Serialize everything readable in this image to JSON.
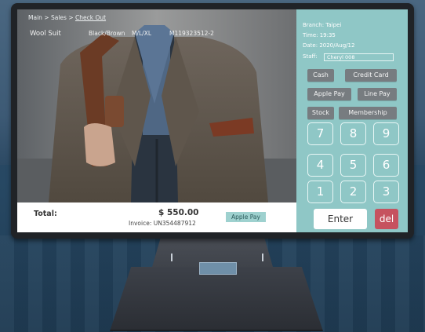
{
  "breadcrumb": {
    "main": "Main",
    "sep1": " > ",
    "sales": "Sales",
    "sep2": " > ",
    "current": "Check Out"
  },
  "product": {
    "name": "Wool Suit",
    "color": "Black/Brown",
    "size": "M/L/XL",
    "sku": "M119323512-2"
  },
  "totals": {
    "label": "Total:",
    "amount": "$ 550.00",
    "invoice": "Invoice: UN354487912",
    "payment_method": "Apple Pay"
  },
  "info": {
    "branch": "Branch: Taipei",
    "time": "Time: 19:35",
    "date": "Date: 2020/Aug/12",
    "staff_label": "Staff:",
    "staff_value": "Cheryl 008"
  },
  "payment_buttons": {
    "cash": "Cash",
    "credit_card": "Credit Card",
    "apple_pay": "Apple Pay",
    "line_pay": "Line Pay",
    "stock": "Stock",
    "membership": "Membership"
  },
  "keypad": [
    "7",
    "8",
    "9",
    "4",
    "5",
    "6",
    "1",
    "2",
    "3"
  ],
  "actions": {
    "enter": "Enter",
    "del": "del"
  },
  "colors": {
    "panel": "#8fc7c6",
    "button": "#777c80",
    "del": "#c6525f",
    "badge": "#9ed1cf"
  }
}
